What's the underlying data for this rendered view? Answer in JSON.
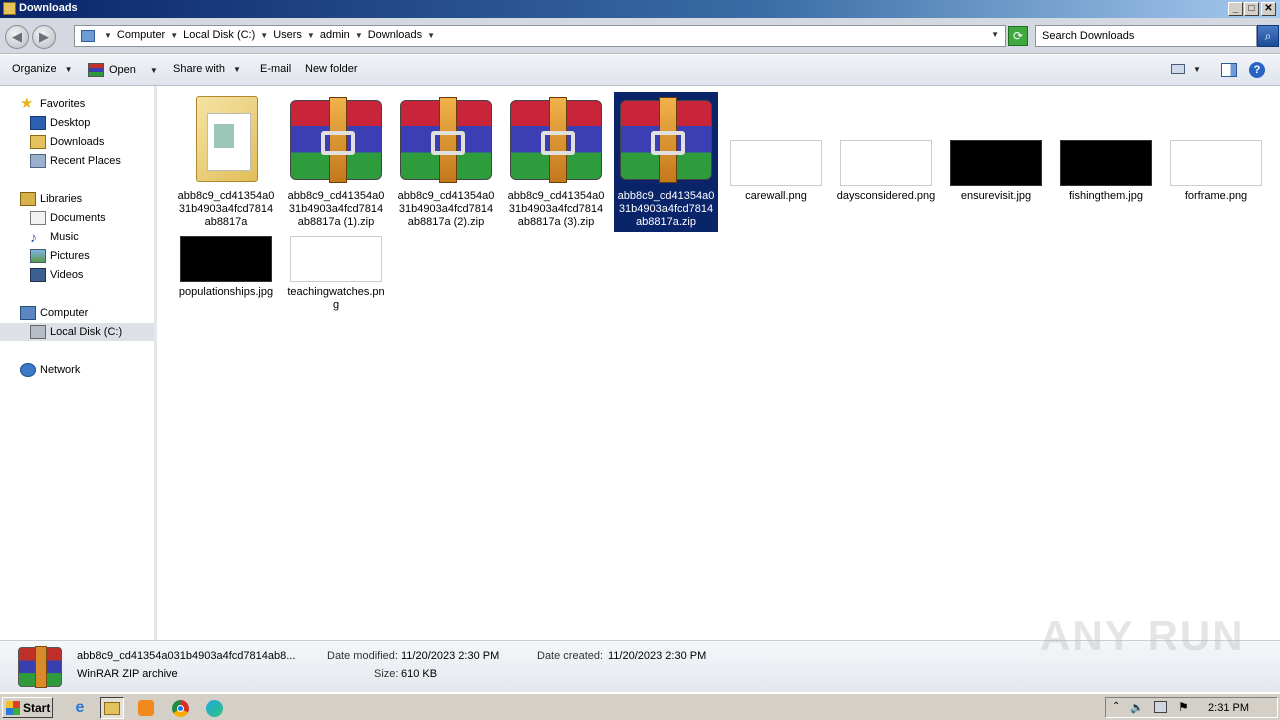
{
  "window": {
    "title": "Downloads"
  },
  "address": {
    "crumbs": [
      "Computer",
      "Local Disk (C:)",
      "Users",
      "admin",
      "Downloads"
    ]
  },
  "search": {
    "placeholder": "Search Downloads"
  },
  "toolbar": {
    "organize": "Organize",
    "open": "Open",
    "share_with": "Share with",
    "email": "E-mail",
    "new_folder": "New folder"
  },
  "nav": {
    "favorites": "Favorites",
    "desktop": "Desktop",
    "downloads": "Downloads",
    "recent_places": "Recent Places",
    "libraries": "Libraries",
    "documents": "Documents",
    "music": "Music",
    "pictures": "Pictures",
    "videos": "Videos",
    "computer": "Computer",
    "local_disk": "Local Disk (C:)",
    "network": "Network"
  },
  "files": [
    {
      "name": "abb8c9_cd41354a031b4903a4fcd7814ab8817a",
      "kind": "folder"
    },
    {
      "name": "abb8c9_cd41354a031b4903a4fcd7814ab8817a (1).zip",
      "kind": "zip"
    },
    {
      "name": "abb8c9_cd41354a031b4903a4fcd7814ab8817a (2).zip",
      "kind": "zip"
    },
    {
      "name": "abb8c9_cd41354a031b4903a4fcd7814ab8817a (3).zip",
      "kind": "zip"
    },
    {
      "name": "abb8c9_cd41354a031b4903a4fcd7814ab8817a.zip",
      "kind": "zip",
      "selected": true
    },
    {
      "name": "carewall.png",
      "kind": "light-thumb"
    },
    {
      "name": "daysconsidered.png",
      "kind": "light-thumb"
    },
    {
      "name": "ensurevisit.jpg",
      "kind": "dark-thumb"
    },
    {
      "name": "fishingthem.jpg",
      "kind": "dark-thumb"
    },
    {
      "name": "forframe.png",
      "kind": "light-thumb"
    },
    {
      "name": "populationships.jpg",
      "kind": "dark-thumb"
    },
    {
      "name": "teachingwatches.png",
      "kind": "light-thumb"
    }
  ],
  "details": {
    "filename": "abb8c9_cd41354a031b4903a4fcd7814ab8...",
    "type": "WinRAR ZIP archive",
    "modified_label": "Date modified:",
    "modified_value": "11/20/2023 2:30 PM",
    "created_label": "Date created:",
    "created_value": "11/20/2023 2:30 PM",
    "size_label": "Size:",
    "size_value": "610 KB"
  },
  "watermark": "ANY RUN",
  "taskbar": {
    "start": "Start",
    "clock": "2:31 PM"
  }
}
